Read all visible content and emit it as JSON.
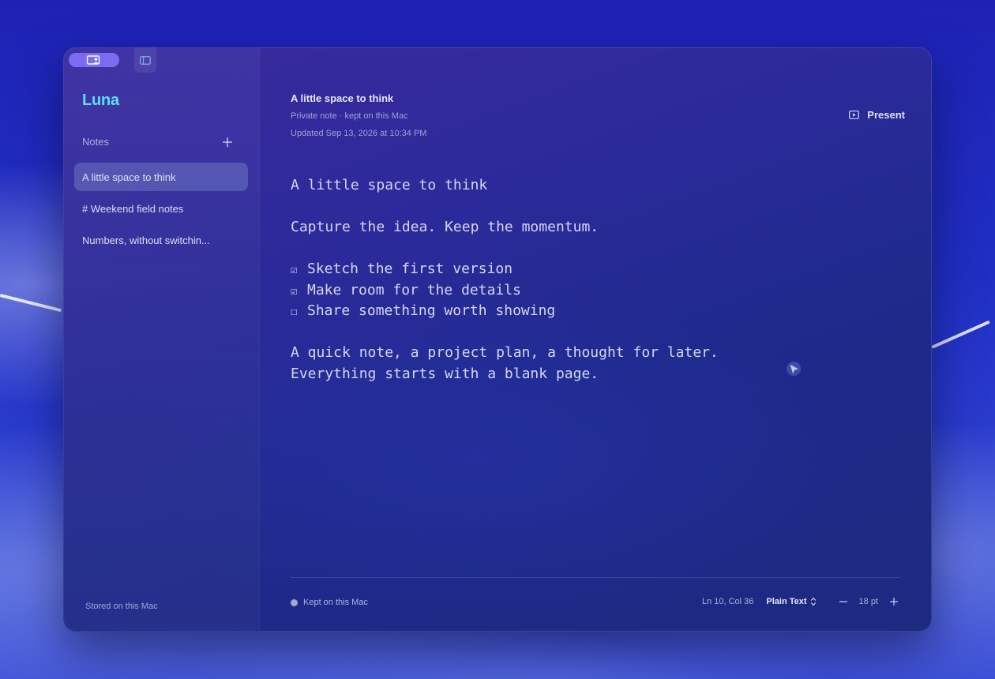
{
  "app": {
    "name": "Luna"
  },
  "sidebar": {
    "section_title": "Notes",
    "notes": [
      {
        "label": "A little space to think",
        "active": true
      },
      {
        "label": "# Weekend field notes",
        "active": false
      },
      {
        "label": "Numbers, without switchin...",
        "active": false
      }
    ],
    "footer": "Stored on this Mac"
  },
  "editor": {
    "title": "A little space to think",
    "meta": "Private note · kept on this Mac",
    "updated": "Updated Sep 13, 2026 at 10:34 PM",
    "present_label": "Present",
    "body": {
      "heading": "A little space to think",
      "tagline": "Capture the idea. Keep the momentum.",
      "tasks": [
        {
          "box": "☑",
          "text": "Sketch the first version"
        },
        {
          "box": "☑",
          "text": "Make room for the details"
        },
        {
          "box": "☐",
          "text": "Share something worth showing"
        }
      ],
      "paragraph_1": "A quick note, a project plan, a thought for later.",
      "paragraph_2": "Everything starts with a blank page."
    }
  },
  "status_bar": {
    "storage": "Kept on this Mac",
    "cursor_position": "Ln 10, Col 36",
    "syntax": "Plain Text",
    "font_size": "18 pt"
  },
  "icons": {
    "account": "account-switcher-icon",
    "sidebar_toggle": "sidebar-toggle-icon",
    "add": "plus-icon",
    "present": "play-rectangle-icon",
    "syntax_chevron": "chevron-up-down-icon",
    "decrease": "minus-icon",
    "increase": "plus-icon"
  },
  "colors": {
    "accent": "#7b6cf2",
    "app_name": "#5de0f5"
  }
}
